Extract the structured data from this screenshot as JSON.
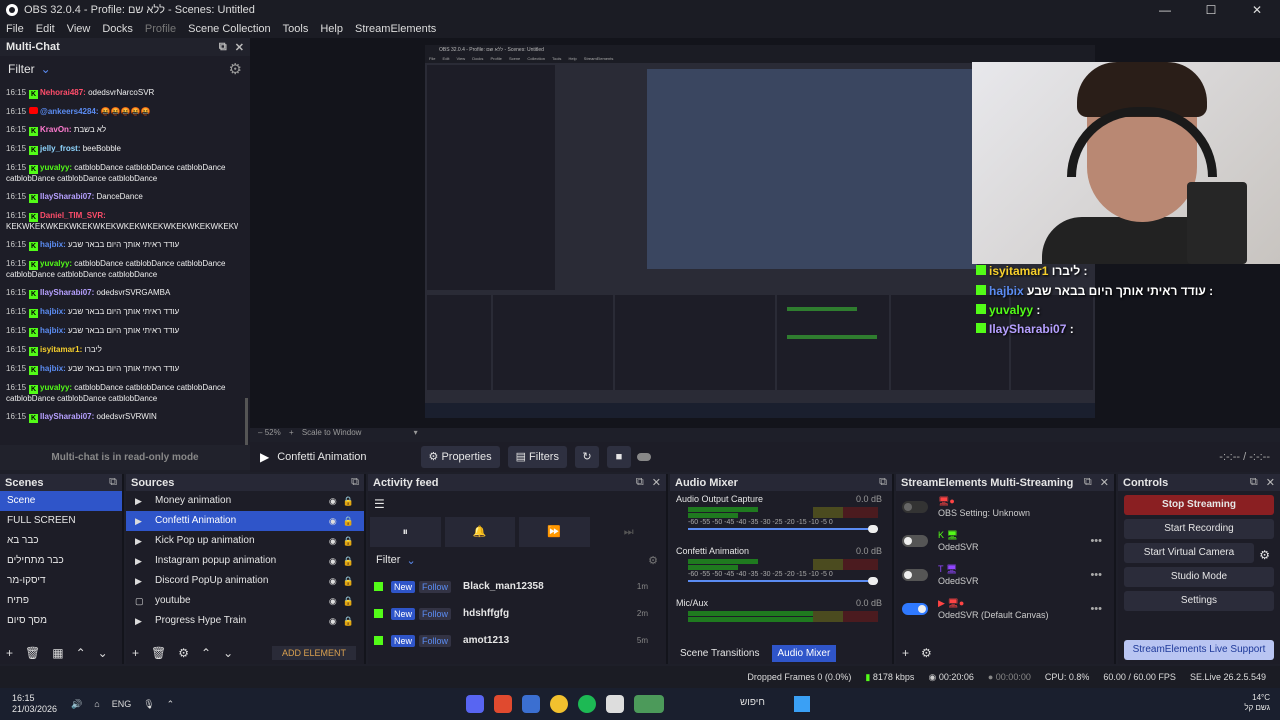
{
  "window": {
    "title": "OBS 32.0.4 - Profile: ללא שם - Scenes: Untitled",
    "minimize": "—",
    "maximize": "☐",
    "close": "✕"
  },
  "menu": [
    "File",
    "Edit",
    "View",
    "Docks",
    "Profile",
    "Scene Collection",
    "Tools",
    "Help",
    "StreamElements"
  ],
  "multichat": {
    "title": "Multi-Chat",
    "filter": "Filter",
    "readonly": "Multi-chat is in read-only mode",
    "messages": [
      {
        "time": "16:15",
        "user": "Nehorai487:",
        "color": "#ff4d6a",
        "text": "odedsvrNarcoSVR",
        "platform": "kick"
      },
      {
        "time": "16:15",
        "user": "@ankeers4284:",
        "color": "#5b8cf2",
        "text": "🤬🤬🤬🤬🤬",
        "platform": "youtube"
      },
      {
        "time": "16:15",
        "user": "KravOn:",
        "color": "#ff7bd0",
        "text": "לא בשבת",
        "platform": "kick"
      },
      {
        "time": "16:15",
        "user": "jelly_frost:",
        "color": "#8fd6ff",
        "text": "beeBobble",
        "platform": "kick"
      },
      {
        "time": "16:15",
        "user": "yuvalyy:",
        "color": "#53fc18",
        "text": "catblobDance catblobDance catblobDance catblobDance catblobDance catblobDance",
        "platform": "kick"
      },
      {
        "time": "16:15",
        "user": "IlaySharabi07:",
        "color": "#b6a0ff",
        "text": "DanceDance",
        "platform": "kick"
      },
      {
        "time": "16:15",
        "user": "Daniel_TIM_SVR:",
        "color": "#ff4d6a",
        "text": "KEKWKEKWKEKWKEKWKEKWKEKWKEKWKEKWKEKWKEKWKEKWKEKWKEKW",
        "platform": "kick"
      },
      {
        "time": "16:15",
        "user": "hajbix:",
        "color": "#5b8cf2",
        "text": "עודד ראיתי אותך היום בבאר שבע",
        "platform": "kick"
      },
      {
        "time": "16:15",
        "user": "yuvalyy:",
        "color": "#53fc18",
        "text": "catblobDance catblobDance catblobDance catblobDance catblobDance catblobDance",
        "platform": "kick"
      },
      {
        "time": "16:15",
        "user": "IlaySharabi07:",
        "color": "#b6a0ff",
        "text": "odedsvrSVRGAMBA",
        "platform": "kick"
      },
      {
        "time": "16:15",
        "user": "hajbix:",
        "color": "#5b8cf2",
        "text": "עודד ראיתי אותך היום בבאר שבע",
        "platform": "kick"
      },
      {
        "time": "16:15",
        "user": "hajbix:",
        "color": "#5b8cf2",
        "text": "עודד ראיתי אותך היום בבאר שבע",
        "platform": "kick"
      },
      {
        "time": "16:15",
        "user": "isyitamar1:",
        "color": "#f7d02c",
        "text": "ליברו",
        "platform": "kick"
      },
      {
        "time": "16:15",
        "user": "hajbix:",
        "color": "#5b8cf2",
        "text": "עודד ראיתי אותך היום בבאר שבע",
        "platform": "kick"
      },
      {
        "time": "16:15",
        "user": "yuvalyy:",
        "color": "#53fc18",
        "text": "catblobDance catblobDance catblobDance catblobDance catblobDance catblobDance",
        "platform": "kick"
      },
      {
        "time": "16:15",
        "user": "IlaySharabi07:",
        "color": "#b6a0ff",
        "text": "odedsvrSVRWIN",
        "platform": "kick"
      }
    ]
  },
  "overlay": [
    {
      "user": "isyitamar1",
      "text": "ליברו :",
      "color": "#f7d02c"
    },
    {
      "user": "hajbix",
      "text": "עודד ראיתי אותך היום בבאר שבע :",
      "color": "#5b8cf2"
    },
    {
      "user": "yuvalyy",
      "text": ":",
      "color": "#53fc18"
    },
    {
      "user": "IlaySharabi07",
      "text": ":",
      "color": "#b6a0ff"
    }
  ],
  "preview": {
    "zoom": "52%",
    "scale": "Scale to Window"
  },
  "scenebar": {
    "scene": "Confetti Animation",
    "properties": "Properties",
    "filters": "Filters",
    "timecode": "-:-:-- / -:-:--"
  },
  "scenes": {
    "title": "Scenes",
    "items": [
      "Scene",
      "FULL SCREEN",
      "כבר בא",
      "כבר מתחילים",
      "דיסקו-מר",
      "פתיח",
      "מסך סיום"
    ]
  },
  "sources": {
    "title": "Sources",
    "items": [
      "Money animation",
      "Confetti Animation",
      "Kick Pop up animation",
      "Instagram popup animation",
      "Discord PopUp animation",
      "youtube",
      "Progress Hype Train"
    ],
    "add": "ADD ELEMENT"
  },
  "activity": {
    "title": "Activity feed",
    "filter": "Filter",
    "new": "New",
    "follow": "Follow",
    "rows": [
      {
        "user": "Black_man12358",
        "ago": "1m"
      },
      {
        "user": "hdshffgfg",
        "ago": "2m"
      },
      {
        "user": "amot1213",
        "ago": "5m"
      }
    ]
  },
  "mixer": {
    "title": "Audio Mixer",
    "channels": [
      {
        "name": "Audio Output Capture",
        "db": "0.0 dB"
      },
      {
        "name": "Confetti Animation",
        "db": "0.0 dB"
      },
      {
        "name": "Mic/Aux",
        "db": "0.0 dB"
      }
    ],
    "ticks": "-60 -55 -50 -45 -40 -35 -30 -25 -20 -15 -10 -5 0",
    "transitions": "Scene Transitions",
    "mixer_tab": "Audio Mixer"
  },
  "se": {
    "title": "StreamElements Multi-Streaming",
    "rows": [
      {
        "name": "OBS Setting: Unknown",
        "sub": ""
      },
      {
        "name": "OdedSVR",
        "sub": ""
      },
      {
        "name": "OdedSVR",
        "sub": ""
      },
      {
        "name": "OdedSVR (Default Canvas)",
        "sub": ""
      }
    ]
  },
  "controls": {
    "title": "Controls",
    "stop": "Stop Streaming",
    "rec": "Start Recording",
    "vcam": "Start Virtual Camera",
    "studio": "Studio Mode",
    "settings": "Settings",
    "support": "StreamElements Live Support"
  },
  "status": {
    "dropped": "Dropped Frames 0 (0.0%)",
    "kbps": "8178 kbps",
    "stream": "00:20:06",
    "rec": "00:00:00",
    "cpu": "CPU: 0.8%",
    "fps": "60.00 / 60.00 FPS",
    "ver": "SE.Live 26.2.5.549"
  },
  "taskbar": {
    "time": "16:15",
    "date": "21/03/2026",
    "lang": "ENG",
    "search": "חיפוש",
    "temp": "14°C",
    "weather": "גשם קל"
  }
}
